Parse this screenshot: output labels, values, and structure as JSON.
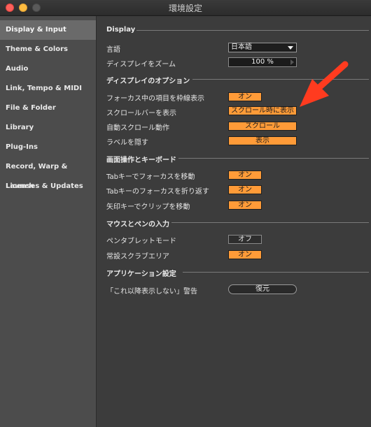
{
  "window": {
    "title": "環境設定"
  },
  "sidebar": {
    "items": [
      {
        "label": "Display & Input",
        "active": true
      },
      {
        "label": "Theme & Colors"
      },
      {
        "label": "Audio"
      },
      {
        "label": "Link, Tempo & MIDI"
      },
      {
        "label": "File & Folder"
      },
      {
        "label": "Library"
      },
      {
        "label": "Plug-Ins"
      },
      {
        "label": "Record, Warp & Launch"
      },
      {
        "label": "Licenses & Updates"
      }
    ]
  },
  "display": {
    "heading": "Display",
    "language_label": "言語",
    "language_value": "日本語",
    "zoom_label": "ディスプレイをズーム",
    "zoom_value": "100 %"
  },
  "display_options": {
    "heading": "ディスプレイのオプション",
    "rows": [
      {
        "label": "フォーカス中の項目を枠線表示",
        "value": "オン"
      },
      {
        "label": "スクロールバーを表示",
        "value": "スクロール時に表示"
      },
      {
        "label": "自動スクロール動作",
        "value": "スクロール"
      },
      {
        "label": "ラベルを隠す",
        "value": "表示"
      }
    ]
  },
  "keyboard": {
    "heading": "画面操作とキーボード",
    "rows": [
      {
        "label": "Tabキーでフォーカスを移動",
        "value": "オン"
      },
      {
        "label": "Tabキーのフォーカスを折り返す",
        "value": "オン"
      },
      {
        "label": "矢印キーでクリップを移動",
        "value": "オン"
      }
    ]
  },
  "pen": {
    "heading": "マウスとペンの入力",
    "rows": [
      {
        "label": "ペンタブレットモード",
        "value": "オフ"
      },
      {
        "label": "常設スクラブエリア",
        "value": "オン"
      }
    ]
  },
  "app_settings": {
    "heading": "アプリケーション設定",
    "warnings_label": "「これ以降表示しない」警告",
    "restore_label": "復元"
  },
  "colors": {
    "accent": "#ff9b38",
    "annotation_arrow": "#ff3b1f"
  }
}
